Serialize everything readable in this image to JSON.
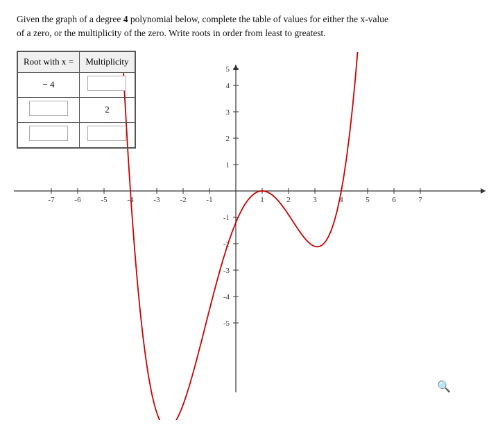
{
  "instructions": {
    "line1": "Given the graph of a degree ",
    "degree": "4",
    "line1b": " polynomial below, complete the table of values for either the x-value",
    "line2": "of a zero, or the multiplicity of the zero. Write roots in order from least to greatest."
  },
  "table": {
    "col1_header": "Root with x =",
    "col2_header": "Multiplicity",
    "rows": [
      {
        "root": "− 4",
        "root_fixed": true,
        "multiplicity": "",
        "mult_fixed": false
      },
      {
        "root": "",
        "root_fixed": false,
        "multiplicity": "2",
        "mult_fixed": true
      },
      {
        "root": "",
        "root_fixed": false,
        "multiplicity": "",
        "mult_fixed": false
      }
    ]
  },
  "graph": {
    "x_min": -7,
    "x_max": 7,
    "y_min": -5,
    "y_max": 5,
    "x_axis_labels": [
      "-7",
      "-6",
      "-5",
      "-4",
      "-3",
      "-2",
      "-1",
      "1",
      "2",
      "3",
      "4",
      "5",
      "6",
      "7"
    ],
    "y_axis_labels": [
      "-5",
      "-4",
      "-3",
      "-2",
      "-1",
      "1",
      "2",
      "3",
      "4",
      "5"
    ]
  },
  "zoom_icon": "🔍"
}
